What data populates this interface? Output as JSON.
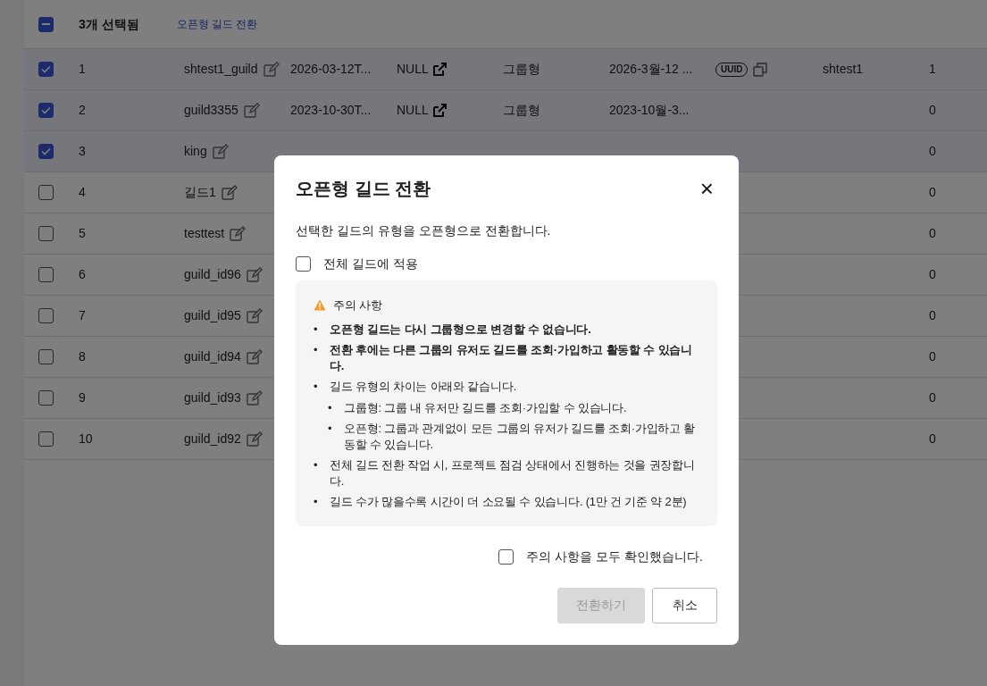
{
  "toolbar": {
    "select_all": {
      "indeterminate": true
    },
    "selected_count": "3개 선택됨",
    "action_link": "오픈형 길드 전환"
  },
  "rows": [
    {
      "selected": true,
      "number": "1",
      "name": "shtest1_guild",
      "created": "2026-03-12T...",
      "link": "NULL",
      "type": "그룹형",
      "date": "2026-3월-12 ...",
      "badge": "UUID",
      "owner": "shtest1",
      "count": "1"
    },
    {
      "selected": true,
      "number": "2",
      "name": "guild3355",
      "created": "2023-10-30T...",
      "link": "NULL",
      "type": "그룹형",
      "date": "2023-10월-3...",
      "count": "0"
    },
    {
      "selected": true,
      "number": "3",
      "name": "king",
      "count": "0"
    },
    {
      "selected": false,
      "number": "4",
      "name": "길드1",
      "count": "0"
    },
    {
      "selected": false,
      "number": "5",
      "name": "testtest",
      "count": "0"
    },
    {
      "selected": false,
      "number": "6",
      "name": "guild_id96",
      "count": "0"
    },
    {
      "selected": false,
      "number": "7",
      "name": "guild_id95",
      "count": "0"
    },
    {
      "selected": false,
      "number": "8",
      "name": "guild_id94",
      "count": "0"
    },
    {
      "selected": false,
      "number": "9",
      "name": "guild_id93",
      "count": "0"
    },
    {
      "selected": false,
      "number": "10",
      "name": "guild_id92",
      "count": "0"
    }
  ],
  "dialog": {
    "title": "오픈형 길드 전환",
    "close": "×",
    "description": "선택한 길드의 유형을 오픈형으로 전환합니다.",
    "apply_all": {
      "label": "전체 길드에 적용",
      "checked": false
    },
    "notice": {
      "title": "주의 사항",
      "items": [
        {
          "bullet": "•",
          "text": "오픈형 길드는 다시 그룹형으로 변경할 수 없습니다.",
          "emphasis": true
        },
        {
          "bullet": "•",
          "text": "전환 후에는 다른 그룹의 유저도 길드를 조회·가입하고 활동할 수 있습니다.",
          "emphasis": true
        },
        {
          "bullet": "•",
          "text": "길드 유형의 차이는 아래와 같습니다.",
          "emphasis": false,
          "children": [
            {
              "bullet": "•",
              "text": "그룹형: 그룹 내 유저만 길드를 조회·가입할 수 있습니다.",
              "emphasis": false
            },
            {
              "bullet": "•",
              "text": "오픈형: 그룹과 관계없이 모든 그룹의 유저가 길드를 조회·가입하고 활동할 수 있습니다.",
              "emphasis": false
            }
          ]
        },
        {
          "bullet": "•",
          "text": "전체 길드 전환 작업 시, 프로젝트 점검 상태에서 진행하는 것을 권장합니다.",
          "emphasis": false
        },
        {
          "bullet": "•",
          "text": "길드 수가 많을수록 시간이 더 소요될 수 있습니다. (1만 건 기준 약 2분)",
          "emphasis": false
        }
      ]
    },
    "confirm_check": {
      "label": "주의 사항을 모두 확인했습니다.",
      "checked": false
    },
    "buttons": [
      {
        "label": "전환하기",
        "kind": "primary",
        "disabled": true
      },
      {
        "label": "취소",
        "kind": "secondary",
        "disabled": false
      }
    ]
  }
}
